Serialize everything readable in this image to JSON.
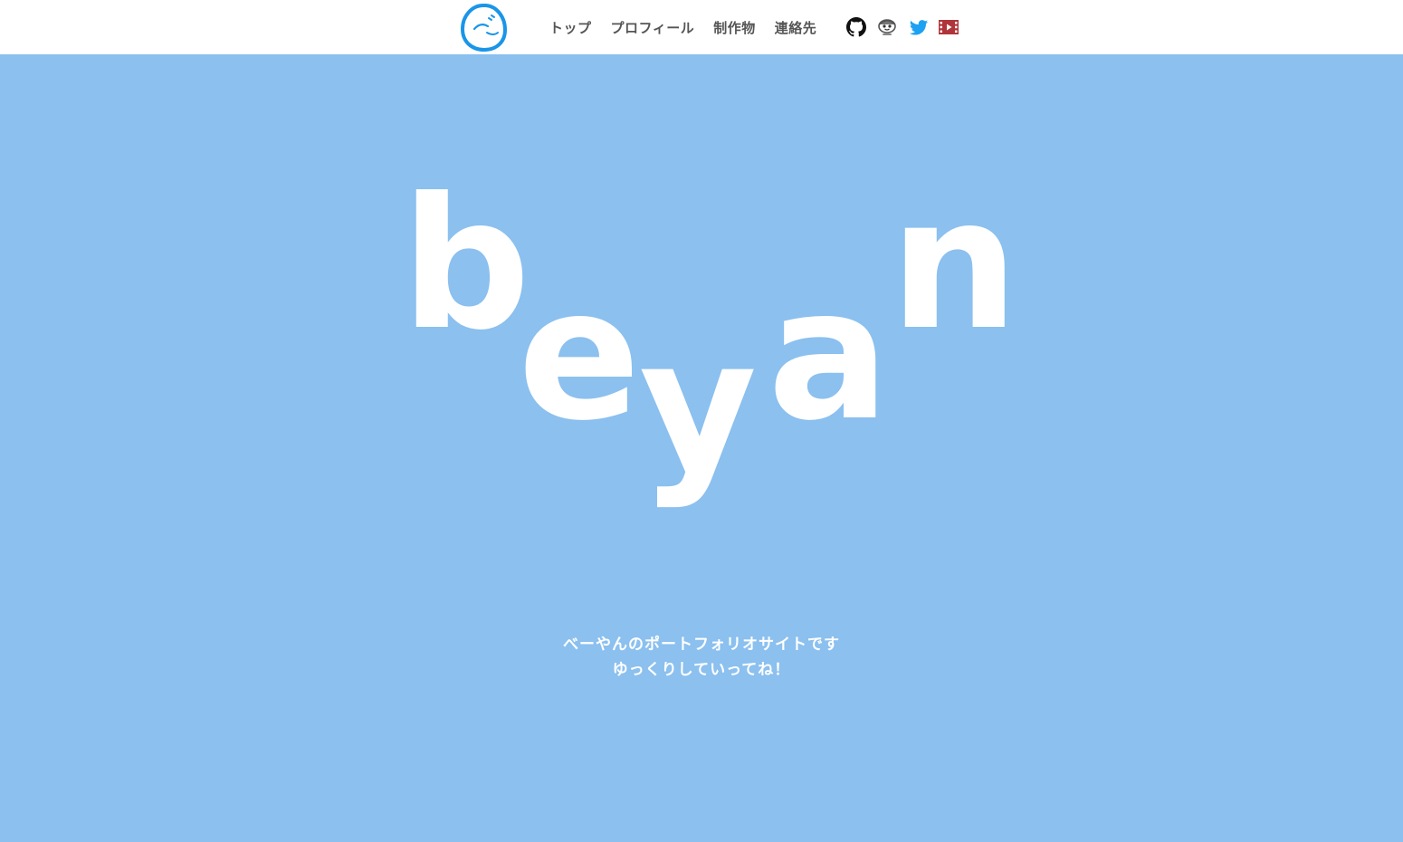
{
  "header": {
    "logo_icon": "face-logo-icon",
    "nav": [
      {
        "label": "トップ"
      },
      {
        "label": "プロフィール"
      },
      {
        "label": "制作物"
      },
      {
        "label": "連絡先"
      }
    ],
    "social": [
      {
        "icon": "github-icon",
        "color": "#111111"
      },
      {
        "icon": "mascot-icon",
        "color": "#555555"
      },
      {
        "icon": "twitter-icon",
        "color": "#1da1f2"
      },
      {
        "icon": "video-icon",
        "color": "#b0353a"
      }
    ]
  },
  "hero": {
    "letters": [
      "b",
      "e",
      "y",
      "a",
      "n"
    ],
    "tagline_line1": "べーやんのポートフォリオサイトです",
    "tagline_line2": "ゆっくりしていってね！"
  },
  "colors": {
    "background": "#8bc0ef",
    "header_bg": "#ffffff",
    "logo_blue": "#1a95e8",
    "nav_text": "#555555"
  }
}
